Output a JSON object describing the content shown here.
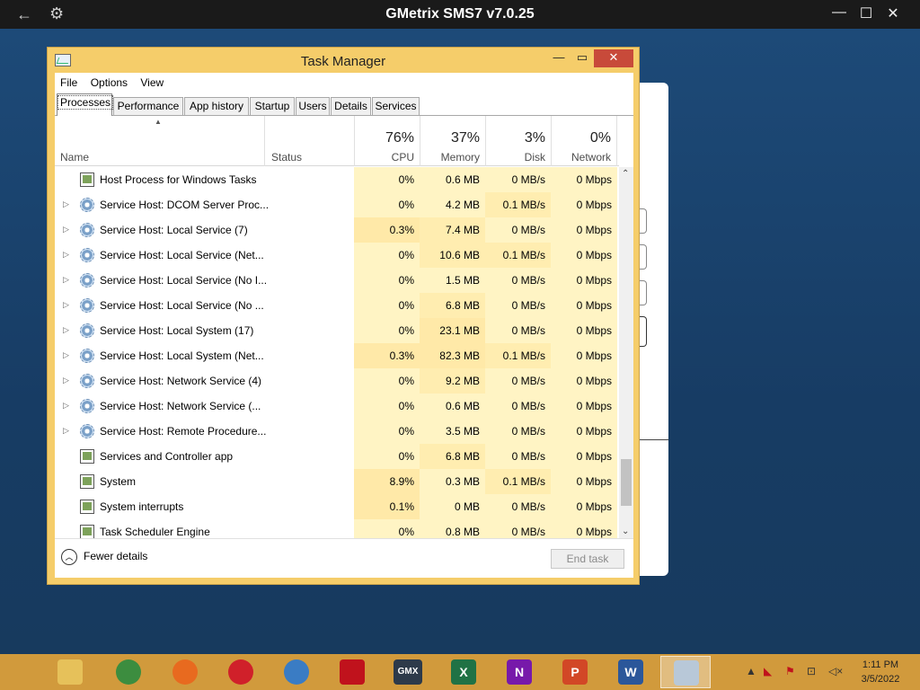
{
  "outer": {
    "title": "GMetrix SMS7 v7.0.25",
    "icons": {
      "back": "arrow-left-icon",
      "settings": "gear-icon"
    },
    "controls": {
      "minimize": "—",
      "maximize": "☐",
      "close": "✕",
      "back": "←",
      "gear": "⚙"
    }
  },
  "tm": {
    "title": "Task Manager",
    "controls": {
      "minimize": "—",
      "maximize": "▭",
      "close": "✕"
    },
    "menu": [
      "File",
      "Options",
      "View"
    ],
    "tabs": [
      "Processes",
      "Performance",
      "App history",
      "Startup",
      "Users",
      "Details",
      "Services"
    ],
    "active_tab": "Processes",
    "columns": {
      "name": "Name",
      "status": "Status",
      "cpu": {
        "pct": "76%",
        "label": "CPU"
      },
      "memory": {
        "pct": "37%",
        "label": "Memory"
      },
      "disk": {
        "pct": "3%",
        "label": "Disk"
      },
      "network": {
        "pct": "0%",
        "label": "Network"
      }
    },
    "rows": [
      {
        "name": "Host Process for Windows Tasks",
        "expandable": false,
        "icon": "window-icon",
        "cpu": "0%",
        "memory": "0.6 MB",
        "disk": "0 MB/s",
        "network": "0 Mbps"
      },
      {
        "name": "Service Host: DCOM Server Proc...",
        "expandable": true,
        "icon": "service-gear-icon",
        "cpu": "0%",
        "memory": "4.2 MB",
        "disk": "0.1 MB/s",
        "network": "0 Mbps"
      },
      {
        "name": "Service Host: Local Service (7)",
        "expandable": true,
        "icon": "service-gear-icon",
        "cpu": "0.3%",
        "memory": "7.4 MB",
        "disk": "0 MB/s",
        "network": "0 Mbps"
      },
      {
        "name": "Service Host: Local Service (Net...",
        "expandable": true,
        "icon": "service-gear-icon",
        "cpu": "0%",
        "memory": "10.6 MB",
        "disk": "0.1 MB/s",
        "network": "0 Mbps"
      },
      {
        "name": "Service Host: Local Service (No I...",
        "expandable": true,
        "icon": "service-gear-icon",
        "cpu": "0%",
        "memory": "1.5 MB",
        "disk": "0 MB/s",
        "network": "0 Mbps"
      },
      {
        "name": "Service Host: Local Service (No ...",
        "expandable": true,
        "icon": "service-gear-icon",
        "cpu": "0%",
        "memory": "6.8 MB",
        "disk": "0 MB/s",
        "network": "0 Mbps"
      },
      {
        "name": "Service Host: Local System (17)",
        "expandable": true,
        "icon": "service-gear-icon",
        "cpu": "0%",
        "memory": "23.1 MB",
        "disk": "0 MB/s",
        "network": "0 Mbps"
      },
      {
        "name": "Service Host: Local System (Net...",
        "expandable": true,
        "icon": "service-gear-icon",
        "cpu": "0.3%",
        "memory": "82.3 MB",
        "disk": "0.1 MB/s",
        "network": "0 Mbps"
      },
      {
        "name": "Service Host: Network Service (4)",
        "expandable": true,
        "icon": "service-gear-icon",
        "cpu": "0%",
        "memory": "9.2 MB",
        "disk": "0 MB/s",
        "network": "0 Mbps"
      },
      {
        "name": "Service Host: Network Service (...",
        "expandable": true,
        "icon": "service-gear-icon",
        "cpu": "0%",
        "memory": "0.6 MB",
        "disk": "0 MB/s",
        "network": "0 Mbps"
      },
      {
        "name": "Service Host: Remote Procedure...",
        "expandable": true,
        "icon": "service-gear-icon",
        "cpu": "0%",
        "memory": "3.5 MB",
        "disk": "0 MB/s",
        "network": "0 Mbps"
      },
      {
        "name": "Services and Controller app",
        "expandable": false,
        "icon": "window-icon",
        "cpu": "0%",
        "memory": "6.8 MB",
        "disk": "0 MB/s",
        "network": "0 Mbps"
      },
      {
        "name": "System",
        "expandable": false,
        "icon": "window-icon",
        "cpu": "8.9%",
        "memory": "0.3 MB",
        "disk": "0.1 MB/s",
        "network": "0 Mbps"
      },
      {
        "name": "System interrupts",
        "expandable": false,
        "icon": "window-icon",
        "cpu": "0.1%",
        "memory": "0 MB",
        "disk": "0 MB/s",
        "network": "0 Mbps"
      },
      {
        "name": "Task Scheduler Engine",
        "expandable": false,
        "icon": "window-icon",
        "cpu": "0%",
        "memory": "0.8 MB",
        "disk": "0 MB/s",
        "network": "0 Mbps"
      }
    ],
    "fewer_details": "Fewer details",
    "end_task": "End task"
  },
  "taskbar": {
    "apps": [
      {
        "name": "file-explorer-icon",
        "label": "",
        "color": "#e6c15a"
      },
      {
        "name": "chrome-icon",
        "label": "",
        "color": "#3c8d3f"
      },
      {
        "name": "firefox-icon",
        "label": "",
        "color": "#e86a1f"
      },
      {
        "name": "opera-icon",
        "label": "",
        "color": "#d0202a"
      },
      {
        "name": "thunderbird-icon",
        "label": "",
        "color": "#3a7cc4"
      },
      {
        "name": "avira-icon",
        "label": "",
        "color": "#c0121c"
      },
      {
        "name": "gmetrix-icon",
        "label": "GMX",
        "color": "#2d3a4a"
      },
      {
        "name": "excel-icon",
        "label": "X",
        "color": "#207245"
      },
      {
        "name": "onenote-icon",
        "label": "N",
        "color": "#7719aa"
      },
      {
        "name": "powerpoint-icon",
        "label": "P",
        "color": "#d24726"
      },
      {
        "name": "word-icon",
        "label": "W",
        "color": "#2b579a"
      },
      {
        "name": "task-manager-icon",
        "label": "",
        "color": "#b8c8d8"
      }
    ],
    "time": "1:11 PM",
    "date": "3/5/2022"
  }
}
